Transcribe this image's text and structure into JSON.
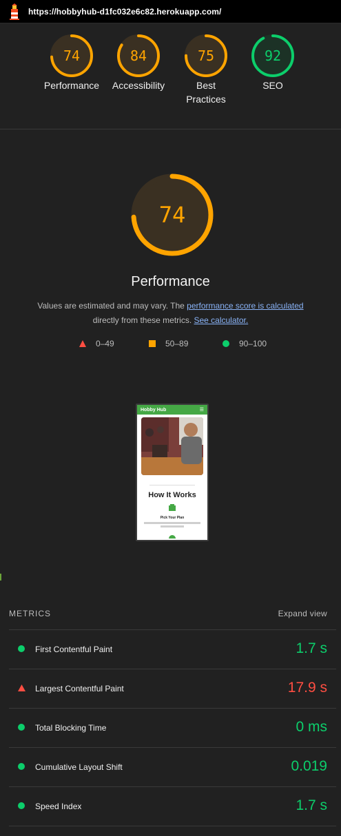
{
  "url": "https://hobbyhub-d1fc032e6c82.herokuapp.com/",
  "colors": {
    "pass": "#0cce6b",
    "average": "#ffa400",
    "fail": "#ff4e42"
  },
  "categories": [
    {
      "label": "Performance",
      "score": "74",
      "value": 74
    },
    {
      "label": "Accessibility",
      "score": "84",
      "value": 84
    },
    {
      "label": "Best Practices",
      "score": "75",
      "value": 75
    },
    {
      "label": "SEO",
      "score": "92",
      "value": 92
    }
  ],
  "performance": {
    "score": "74",
    "value": 74,
    "title": "Performance",
    "desc_prefix": "Values are estimated and may vary. The ",
    "desc_link1": "performance score is calculated",
    "desc_mid": "directly from these metrics. ",
    "desc_link2": "See calculator."
  },
  "legend": [
    {
      "range": "0–49",
      "icon": "triangle-icon"
    },
    {
      "range": "50–89",
      "icon": "square-icon"
    },
    {
      "range": "90–100",
      "icon": "circle-icon"
    }
  ],
  "thumbnail": {
    "brand": "Hobby Hub",
    "heading": "How It Works",
    "step": "Pick Your Plan"
  },
  "metrics": {
    "header": "METRICS",
    "expand": "Expand view",
    "items": [
      {
        "name": "First Contentful Paint",
        "value": "1.7 s",
        "status": "pass"
      },
      {
        "name": "Largest Contentful Paint",
        "value": "17.9 s",
        "status": "fail"
      },
      {
        "name": "Total Blocking Time",
        "value": "0 ms",
        "status": "pass"
      },
      {
        "name": "Cumulative Layout Shift",
        "value": "0.019",
        "status": "pass"
      },
      {
        "name": "Speed Index",
        "value": "1.7 s",
        "status": "pass"
      }
    ]
  }
}
